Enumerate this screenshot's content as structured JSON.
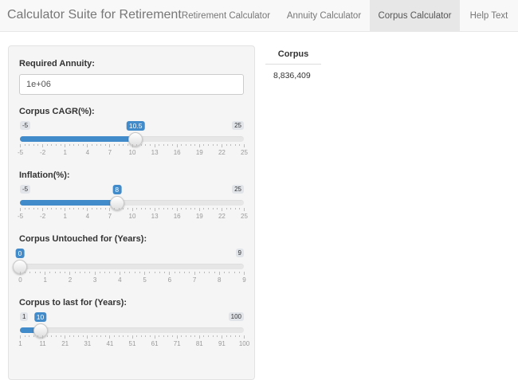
{
  "app": {
    "title": "Calculator Suite for Retirement"
  },
  "nav": {
    "tabs": [
      {
        "label": "Retirement Calculator",
        "active": false
      },
      {
        "label": "Annuity Calculator",
        "active": false
      },
      {
        "label": "Corpus Calculator",
        "active": true
      },
      {
        "label": "Help Text",
        "active": false
      }
    ]
  },
  "inputs": {
    "annuity": {
      "label": "Required Annuity:",
      "value": "1e+06"
    },
    "sliders": [
      {
        "id": "cagr",
        "label": "Corpus CAGR(%):",
        "min": -5,
        "max": 25,
        "value": 10.5,
        "min_label": "-5",
        "max_label": "25",
        "value_label": "10.5",
        "ticks": [
          "-5",
          "-2",
          "1",
          "4",
          "7",
          "10",
          "13",
          "16",
          "19",
          "22",
          "25"
        ]
      },
      {
        "id": "inflation",
        "label": "Inflation(%):",
        "min": -5,
        "max": 25,
        "value": 8,
        "min_label": "-5",
        "max_label": "25",
        "value_label": "8",
        "ticks": [
          "-5",
          "-2",
          "1",
          "4",
          "7",
          "10",
          "13",
          "16",
          "19",
          "22",
          "25"
        ]
      },
      {
        "id": "untouched",
        "label": "Corpus Untouched for (Years):",
        "min": 0,
        "max": 9,
        "value": 0,
        "min_label": "",
        "max_label": "9",
        "value_label": "0",
        "ticks": [
          "0",
          "1",
          "2",
          "3",
          "4",
          "5",
          "6",
          "7",
          "8",
          "9"
        ]
      },
      {
        "id": "last",
        "label": "Corpus to last for (Years):",
        "min": 1,
        "max": 100,
        "value": 10,
        "min_label": "1",
        "max_label": "100",
        "value_label": "10",
        "ticks": [
          "1",
          "11",
          "21",
          "31",
          "41",
          "51",
          "61",
          "71",
          "81",
          "91",
          "100"
        ]
      }
    ]
  },
  "output": {
    "header": "Corpus",
    "value": "8,836,409"
  },
  "colors": {
    "accent": "#428bca",
    "track": "#e6e6e6",
    "navbar": "#f8f8f8",
    "panel": "#f5f5f5"
  }
}
